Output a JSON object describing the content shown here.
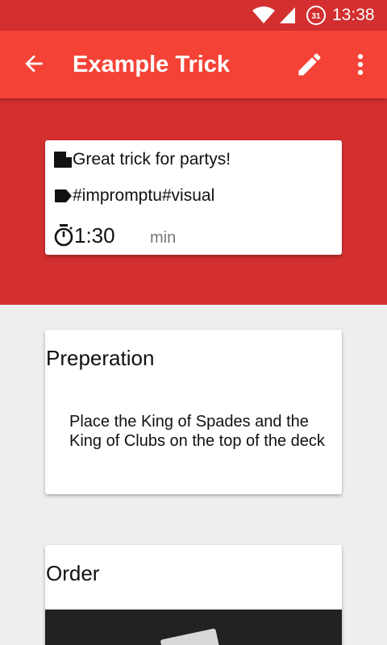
{
  "status_bar": {
    "time": "13:38",
    "calendar_day": "31"
  },
  "app_bar": {
    "title": "Example Trick"
  },
  "info": {
    "description": "Great trick for partys!",
    "tags": "#impromptu#visual",
    "duration": "1:30",
    "duration_unit": "min"
  },
  "preparation": {
    "title": "Preperation",
    "text": "Place the King of Spades and the King of Clubs on the top of the deck"
  },
  "order": {
    "title": "Order"
  },
  "colors": {
    "primary": "#f44336",
    "primary_dark": "#d32f2f",
    "background": "#eeeeee"
  }
}
